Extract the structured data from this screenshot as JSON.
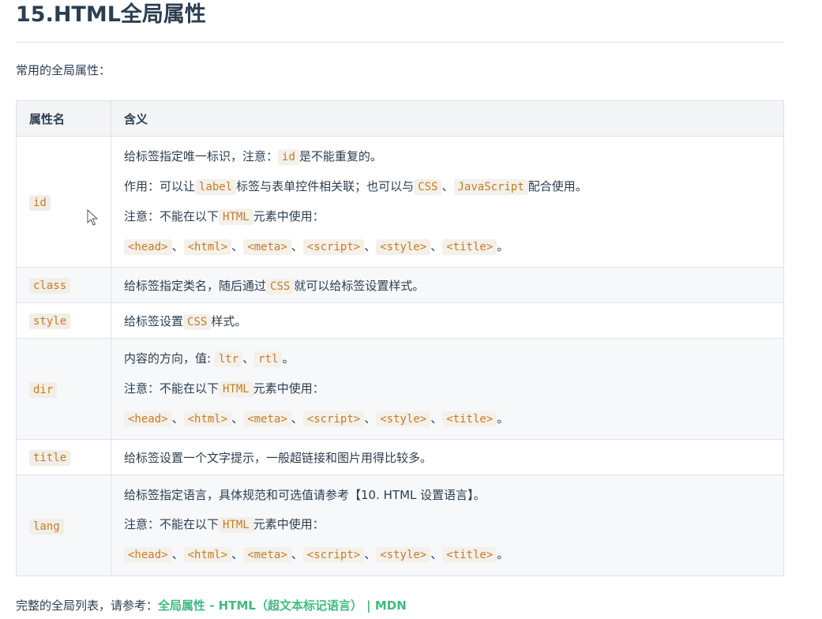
{
  "heading": "15.HTML全局属性",
  "intro": "常用的全局属性：",
  "table": {
    "headers": [
      "属性名",
      "含义"
    ],
    "restricted": [
      "<head>",
      "<html>",
      "<meta>",
      "<script>",
      "<style>",
      "<title>"
    ],
    "sep": "、",
    "end": "。",
    "rows": {
      "id": {
        "name": "id",
        "l1a": "给标签指定唯一标识，注意：",
        "l1code": "id",
        "l1b": "是不能重复的。",
        "l2a": "作用：可以让",
        "l2code1": "label",
        "l2b": "标签与表单控件相关联；也可以与",
        "l2code2": "CSS",
        "l2c": "、",
        "l2code3": "JavaScript",
        "l2d": "配合使用。",
        "l3a": "注意：不能在以下",
        "l3code": "HTML",
        "l3b": "元素中使用："
      },
      "class": {
        "name": "class",
        "a": "给标签指定类名，随后通过",
        "code": "CSS",
        "b": "就可以给标签设置样式。"
      },
      "style": {
        "name": "style",
        "a": "给标签设置",
        "code": "CSS",
        "b": "样式。"
      },
      "dir": {
        "name": "dir",
        "l1a": "内容的方向，值:",
        "code1": "ltr",
        "sep": "、",
        "code2": "rtl",
        "end": "。",
        "l2a": "注意：不能在以下",
        "l2code": "HTML",
        "l2b": "元素中使用："
      },
      "title": {
        "name": "title",
        "text": "给标签设置一个文字提示，一般超链接和图片用得比较多。"
      },
      "lang": {
        "name": "lang",
        "l1": "给标签指定语言，具体规范和可选值请参考【10. HTML 设置语言】。",
        "l2a": "注意：不能在以下",
        "l2code": "HTML",
        "l2b": "元素中使用："
      }
    }
  },
  "footer": {
    "prefix": "完整的全局列表，请参考：",
    "link": "全局属性 - HTML（超文本标记语言） | MDN"
  }
}
